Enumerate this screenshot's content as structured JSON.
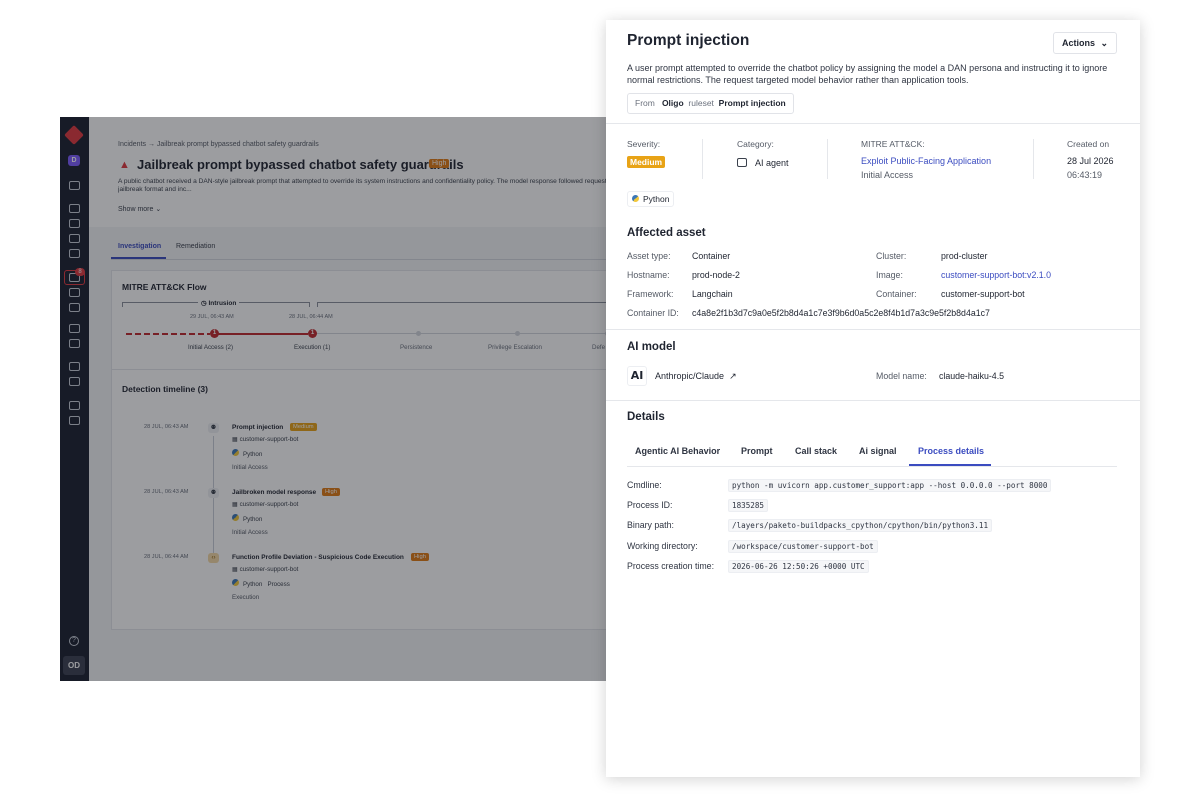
{
  "background_app": {
    "rail": {
      "workspace_initial": "D",
      "alert_count": "8",
      "help_glyph": "?",
      "user_initials": "OD"
    },
    "breadcrumb": "Incidents → Jailbreak prompt bypassed chatbot safety guardrails",
    "title": "Jailbreak prompt bypassed chatbot safety guardrails",
    "title_badge": "High",
    "description": "A public chatbot received a DAN-style jailbreak prompt that attempted to override its system instructions and confidentiality policy. The model response followed requested jailbreak format and inc...",
    "show_more": "Show more",
    "tabs": [
      "Investigation",
      "Remediation"
    ],
    "flow": {
      "title": "MITRE ATT&CK Flow",
      "group_label": "Intrusion",
      "timestamps": [
        "29 JUL, 06:43 AM",
        "28 JUL, 06:44 AM"
      ],
      "stages": [
        {
          "label": "Initial Access (2)",
          "count": "1"
        },
        {
          "label": "Execution (1)",
          "count": "1"
        },
        {
          "label": "Persistence"
        },
        {
          "label": "Privilege Escalation"
        },
        {
          "label": "Defe"
        }
      ]
    },
    "timeline": {
      "title": "Detection timeline (3)",
      "events": [
        {
          "time": "28 JUL, 06:43 AM",
          "name": "Prompt injection",
          "severity": "Medium",
          "asset": "customer-support-bot",
          "lang": "Python",
          "extra": "",
          "phase": "Initial Access"
        },
        {
          "time": "28 JUL, 06:43 AM",
          "name": "Jailbroken model response",
          "severity": "High",
          "asset": "customer-support-bot",
          "lang": "Python",
          "extra": "",
          "phase": "Initial Access"
        },
        {
          "time": "28 JUL, 06:44 AM",
          "name": "Function Profile Deviation - Suspicious Code Execution",
          "severity": "High",
          "asset": "customer-support-bot",
          "lang": "Python",
          "extra": "Process",
          "phase": "Execution"
        }
      ]
    }
  },
  "drawer": {
    "title": "Prompt injection",
    "actions_label": "Actions",
    "description": "A user prompt attempted to override the chatbot policy by assigning the model a DAN persona and instructing it to ignore normal restrictions. The request targeted model behavior rather than application tools.",
    "source": {
      "from_label": "From",
      "vendor": "Oligo",
      "ruleset_label": "ruleset",
      "ruleset": "Prompt injection"
    },
    "meta": {
      "severity_label": "Severity:",
      "severity": "Medium",
      "category_label": "Category:",
      "category": "AI agent",
      "mitre_label": "MITRE ATT&CK:",
      "mitre_technique": "Exploit Public-Facing Application",
      "mitre_tactic": "Initial Access",
      "created_label": "Created on",
      "created_date": "28 Jul 2026",
      "created_time": "06:43:19"
    },
    "language": "Python",
    "affected_asset": {
      "title": "Affected asset",
      "asset_type_label": "Asset type:",
      "asset_type": "Container",
      "hostname_label": "Hostname:",
      "hostname": "prod-node-2",
      "framework_label": "Framework:",
      "framework": "Langchain",
      "container_id_label": "Container ID:",
      "container_id": "c4a8e2f1b3d7c9a0e5f2b8d4a1c7e3f9b6d0a5c2e8f4b1d7a3c9e5f2b8d4a1c7",
      "cluster_label": "Cluster:",
      "cluster": "prod-cluster",
      "image_label": "Image:",
      "image": "customer-support-bot:v2.1.0",
      "container_label": "Container:",
      "container": "customer-support-bot"
    },
    "ai_model": {
      "title": "AI model",
      "provider": "Anthropic/Claude",
      "provider_logo": "AI",
      "model_name_label": "Model name:",
      "model_name": "claude-haiku-4.5"
    },
    "details": {
      "title": "Details",
      "tabs": [
        "Agentic AI Behavior",
        "Prompt",
        "Call stack",
        "Ai signal",
        "Process details"
      ],
      "active_tab": "Process details",
      "process": [
        {
          "label": "Cmdline:",
          "value": "python -m uvicorn app.customer_support:app --host 0.0.0.0 --port 8000"
        },
        {
          "label": "Process ID:",
          "value": "1835285"
        },
        {
          "label": "Binary path:",
          "value": "/layers/paketo-buildpacks_cpython/cpython/bin/python3.11"
        },
        {
          "label": "Working directory:",
          "value": "/workspace/customer-support-bot"
        },
        {
          "label": "Process creation time:",
          "value": "2026-06-26 12:50:26 +0000 UTC"
        }
      ]
    }
  },
  "colors": {
    "accent": "#3b4cc0",
    "high": "#e07b14",
    "medium": "#e8a316",
    "danger": "#c0282d",
    "rail": "#1b2030"
  }
}
